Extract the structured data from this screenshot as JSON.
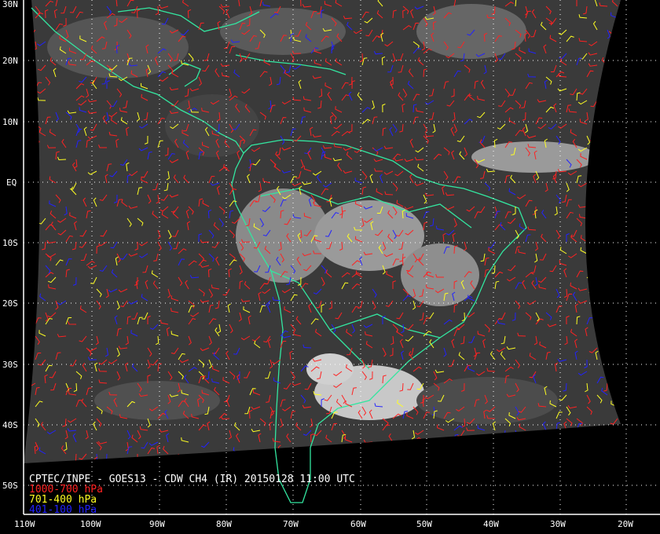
{
  "title": "CPTEC/INPE - GOES13 - CDW CH4 (IR) 20150128 11:00 UTC",
  "legend": [
    {
      "label": "1000-700 hPa",
      "color": "#ff2222"
    },
    {
      "label": "701-400 hPa",
      "color": "#ffff22"
    },
    {
      "label": "401-100 hPa",
      "color": "#2222ff"
    }
  ],
  "colors": {
    "coast": "#33e6a0",
    "grid": "#ffffff",
    "background": "#000000",
    "frame": "#ffffff"
  },
  "lat_labels": [
    "30N",
    "20N",
    "10N",
    "EQ",
    "10S",
    "20S",
    "30S",
    "40S",
    "50S"
  ],
  "lon_labels": [
    "110W",
    "100W",
    "90W",
    "80W",
    "70W",
    "60W",
    "50W",
    "40W",
    "30W",
    "20W"
  ]
}
